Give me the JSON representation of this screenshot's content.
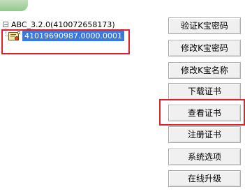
{
  "tree": {
    "root_label": "ABC_3.2.0(410072658173)",
    "root_expand_glyph": "−",
    "child_label": "41019690987.0000.0001",
    "child_icon": "certificate-icon"
  },
  "buttons": [
    {
      "label": "验证K宝密码"
    },
    {
      "label": "修改K宝密码"
    },
    {
      "label": "修改K宝名称"
    },
    {
      "label": "下载证书"
    },
    {
      "label": "查看证书"
    },
    {
      "label": "注册证书"
    },
    {
      "label": "系统选项"
    },
    {
      "label": "在线升级"
    }
  ],
  "colors": {
    "highlight": "#e0202c",
    "selection": "#3b78d8"
  }
}
